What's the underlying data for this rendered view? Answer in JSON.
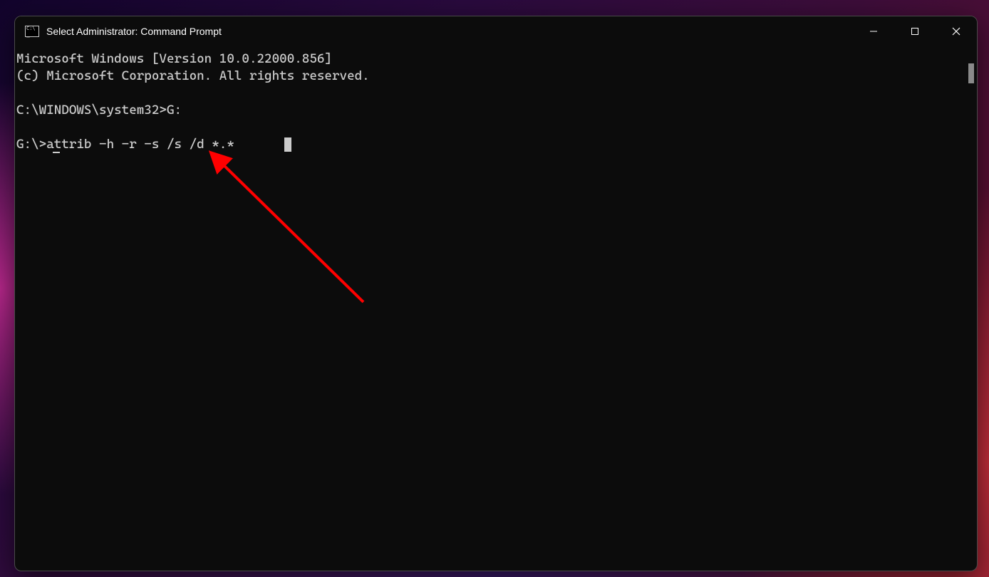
{
  "window": {
    "title": "Select Administrator: Command Prompt"
  },
  "terminal": {
    "lines": {
      "l0": "Microsoft Windows [Version 10.0.22000.856]",
      "l1": "(c) Microsoft Corporation. All rights reserved.",
      "l2": "",
      "l3": "C:\\WINDOWS\\system32>G:",
      "l4": "",
      "l5_prompt": "G:\\>",
      "l5_cmd": "attrib -h -r -s /s /d *.*"
    }
  },
  "annotation": {
    "arrow_color": "#ff0000"
  }
}
